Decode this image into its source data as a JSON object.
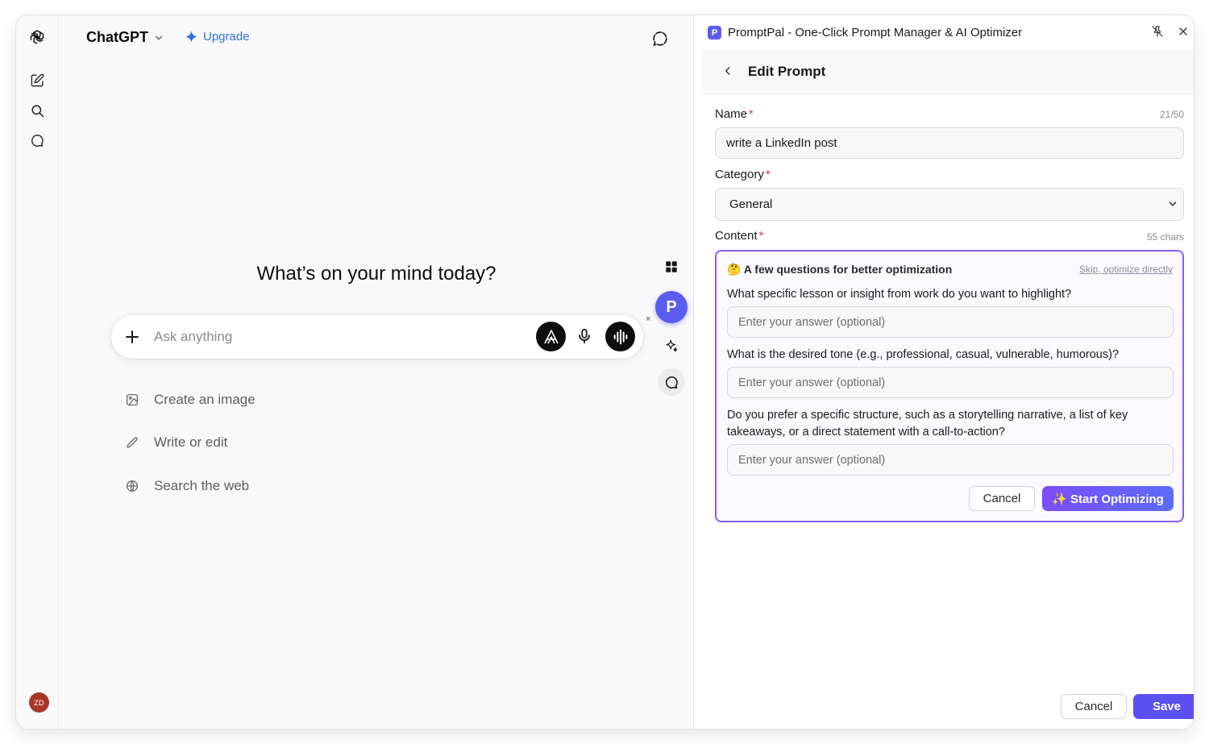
{
  "chatgpt": {
    "model_name": "ChatGPT",
    "upgrade_label": "Upgrade",
    "greeting": "What’s on your mind today?",
    "composer_placeholder": "Ask anything",
    "suggestions": [
      {
        "label": "Create an image",
        "icon": "image-icon"
      },
      {
        "label": "Write or edit",
        "icon": "pencil-icon"
      },
      {
        "label": "Search the web",
        "icon": "globe-icon"
      }
    ],
    "avatar_initials": "ZD",
    "floating_badge": "P",
    "floating_close": "×"
  },
  "promptpal": {
    "logo_letter": "P",
    "title": "PromptPal - One-Click Prompt Manager & AI Optimizer",
    "subheader_title": "Edit Prompt",
    "name_label": "Name",
    "name_value": "write a LinkedIn post",
    "name_counter": "21/50",
    "category_label": "Category",
    "category_value": "General",
    "content_label": "Content",
    "content_counter": "55 chars",
    "required_mark": "*",
    "optimization": {
      "heading": "🤔 A few questions for better optimization",
      "skip_label": "Skip, optimize directly",
      "questions": [
        {
          "text": "What specific lesson or insight from work do you want to highlight?",
          "placeholder": "Enter your answer (optional)"
        },
        {
          "text": "What is the desired tone (e.g., professional, casual, vulnerable, humorous)?",
          "placeholder": "Enter your answer (optional)"
        },
        {
          "text": "Do you prefer a specific structure, such as a storytelling narrative, a list of key takeaways, or a direct statement with a call-to-action?",
          "placeholder": "Enter your answer (optional)"
        }
      ],
      "cancel_label": "Cancel",
      "start_label": "✨ Start Optimizing"
    },
    "footer": {
      "cancel_label": "Cancel",
      "save_label": "Save"
    }
  },
  "colors": {
    "accent": "#5b5bf0",
    "optimize_border": "#8b5cf6",
    "upgrade_blue": "#2f6fea",
    "required_red": "#e5393a",
    "avatar_bg": "#a8352b"
  }
}
